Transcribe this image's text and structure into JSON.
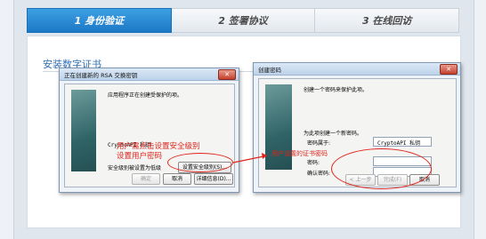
{
  "steps": [
    {
      "label": "1 身份验证",
      "active": true
    },
    {
      "label": "2 签署协议",
      "active": false
    },
    {
      "label": "3 在线回访",
      "active": false
    }
  ],
  "section_title": "安装数字证书",
  "dialog1": {
    "title": "正在创建新的 RSA 交换密钥",
    "close": "✕",
    "message": "应用程序正在创建受保护的项。",
    "item_name": "CryptoAPI 私钥",
    "security_level_label": "安全级别被设置为低级",
    "set_security_button": "设置安全级别(S)...",
    "ok_button": "确定",
    "cancel_button": "取消",
    "details_button": "详细信息(D)..."
  },
  "dialog2": {
    "title": "创建密码",
    "close": "✕",
    "message": "创建一个密码来保护此项。",
    "create_prompt": "为此项创建一个新密码。",
    "password_for_label": "密码属于:",
    "password_for_value": "CryptoAPI 私钥",
    "password_label": "密码:",
    "confirm_label": "确认密码:",
    "password_value": "",
    "confirm_value": "",
    "back_button": "< 上一步",
    "finish_button": "完成(F)",
    "cancel_button": "取消"
  },
  "annotations": {
    "note1_line1": "用户需点击设置安全级别",
    "note1_line2": "设置用户密码",
    "note2": "用户设置的证书密码",
    "color": "#e0241b"
  }
}
